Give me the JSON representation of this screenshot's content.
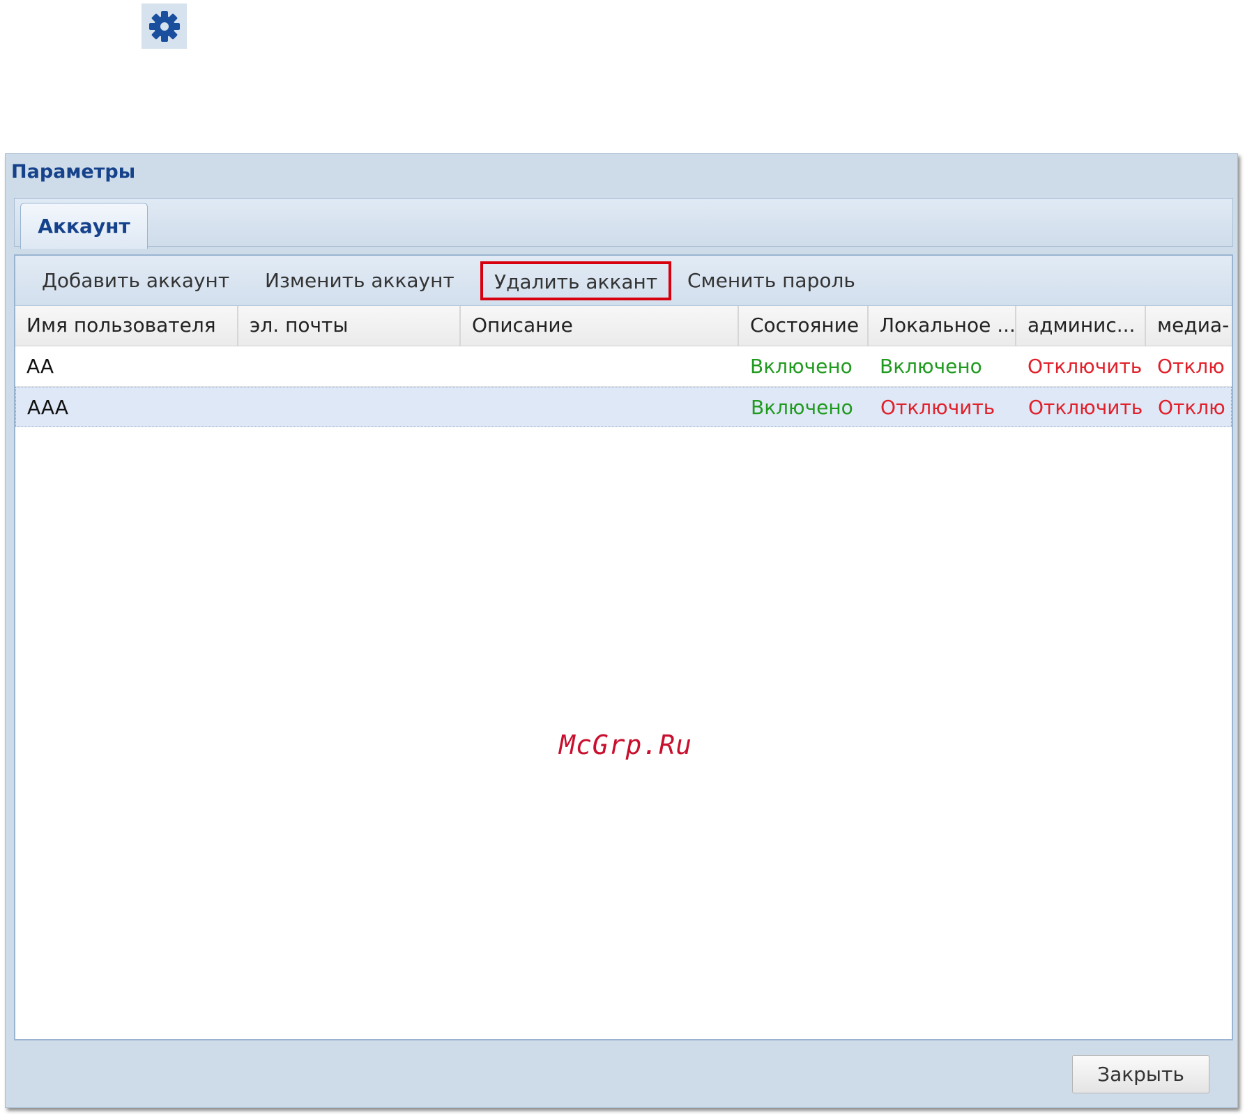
{
  "app_icon": "gear-icon",
  "dialog": {
    "title": "Параметры",
    "tabs": [
      {
        "label": "Аккаунт",
        "active": true
      }
    ],
    "toolbar": {
      "add_label": "Добавить аккаунт",
      "edit_label": "Изменить аккаунт",
      "delete_label": "Удалить аккант",
      "change_password_label": "Сменить пароль"
    },
    "grid": {
      "columns": [
        "Имя пользователя",
        "эл. почты",
        "Описание",
        "Состояние",
        "Локальное ...",
        "админис...",
        "медиа-"
      ],
      "rows": [
        {
          "username": "AA",
          "email": "",
          "description": "",
          "state": "Включено",
          "local": "Включено",
          "admin": "Отключить",
          "media": "Отклю"
        },
        {
          "username": "AAA",
          "email": "",
          "description": "",
          "state": "Включено",
          "local": "Отключить",
          "admin": "Отключить",
          "media": "Отклю",
          "selected": true
        }
      ]
    },
    "close_label": "Закрыть"
  },
  "watermark": "McGrp.Ru",
  "colors": {
    "title_blue": "#15428b",
    "enabled_green": "#1f9a1f",
    "disabled_red": "#e0202a",
    "highlight_red": "#d7000f"
  }
}
